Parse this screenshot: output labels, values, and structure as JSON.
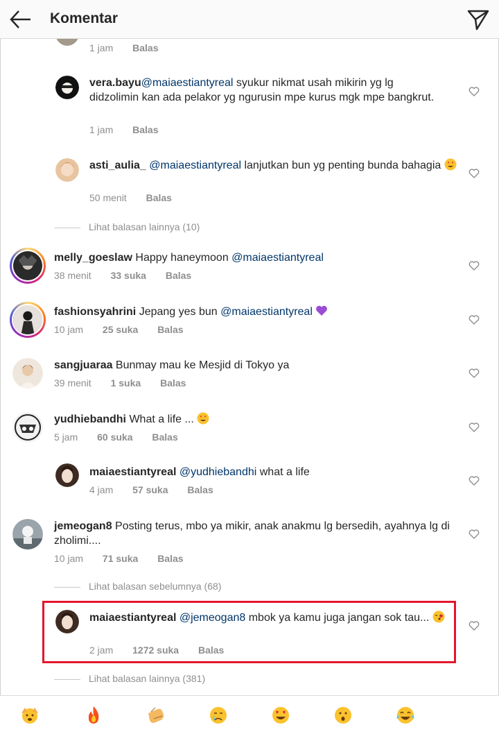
{
  "header": {
    "title": "Komentar",
    "back_icon": "arrow-left-icon",
    "send_icon": "paper-plane-icon"
  },
  "accent_colors": {
    "mention": "#003569",
    "meta": "#8e8e8e",
    "highlight": "#e3162d"
  },
  "comments": [
    {
      "time": "1 jam",
      "reply_label": "Balas"
    },
    {
      "username": "vera.bayu",
      "mention": "@maiaestiantyreal",
      "text": " syukur nikmat usah mikirin yg lg didzolimin kan ada pelakor yg ngurusin mpe kurus mgk mpe bangkrut.",
      "time": "1 jam",
      "reply_label": "Balas"
    },
    {
      "username": "asti_aulia_",
      "mention": "@maiaestiantyreal",
      "text": " lanjutkan bun yg penting bunda bahagia",
      "emoji": "heart-eyes",
      "time": "50 menit",
      "reply_label": "Balas"
    },
    {
      "more_replies": "Lihat balasan lainnya (10)"
    },
    {
      "username": "melly_goeslaw",
      "text": " Happy haneymoon ",
      "mention": "@maiaestiantyreal",
      "time": "38 menit",
      "likes": "33 suka",
      "reply_label": "Balas"
    },
    {
      "username": "fashionsyahrini",
      "text": " Jepang yes bun ",
      "mention": "@maiaestiantyreal",
      "emoji": "purple-heart",
      "time": "10 jam",
      "likes": "25 suka",
      "reply_label": "Balas"
    },
    {
      "username": "sangjuaraa",
      "text": " Bunmay mau ke Mesjid di Tokyo ya",
      "time": "39 menit",
      "likes": "1 suka",
      "reply_label": "Balas"
    },
    {
      "username": "yudhiebandhi",
      "text": " What a life ... ",
      "emoji": "heart-eyes",
      "time": "5 jam",
      "likes": "60 suka",
      "reply_label": "Balas"
    },
    {
      "username": "maiaestiantyreal",
      "mention": "@yudhiebandhi",
      "text": " what a life",
      "time": "4 jam",
      "likes": "57 suka",
      "reply_label": "Balas"
    },
    {
      "username": "jemeogan8",
      "text": " Posting terus, mbo ya mikir, anak anakmu lg bersedih, ayahnya lg di zholimi....",
      "time": "10 jam",
      "likes": "71 suka",
      "reply_label": "Balas"
    },
    {
      "more_replies": "Lihat balasan sebelumnya (68)"
    },
    {
      "username": "maiaestiantyreal",
      "mention": "@jemeogan8",
      "text": " mbok ya kamu juga jangan sok tau...",
      "emoji": "kiss",
      "time": "2 jam",
      "likes": "1272 suka",
      "reply_label": "Balas"
    },
    {
      "more_replies": "Lihat balasan lainnya (381)"
    }
  ],
  "emoji_bar": [
    "face-with-hands-icon",
    "fire-icon",
    "clapping-hands-icon",
    "crying-face-icon",
    "heart-eyes-icon",
    "surprised-face-icon",
    "tears-of-joy-icon"
  ]
}
